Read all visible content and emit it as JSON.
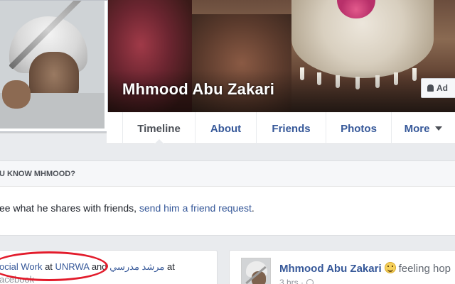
{
  "profile": {
    "name": "Mhmood Abu Zakari",
    "add_friend_label": "Ad"
  },
  "tabs": [
    {
      "label": "Timeline",
      "active": true
    },
    {
      "label": "About"
    },
    {
      "label": "Friends"
    },
    {
      "label": "Photos"
    },
    {
      "label": "More"
    }
  ],
  "know": {
    "heading": "U KNOW MHMOOD?",
    "body_prefix": "ee what he shares with friends, ",
    "body_link": "send him a friend request",
    "body_suffix": "."
  },
  "work": {
    "job": "ocial Work",
    "at1": " at ",
    "employer": "UNRWA",
    "and": " and ",
    "arabic_title": "مرشد مدرسي",
    "at2": " at",
    "via": "acebook"
  },
  "post": {
    "author": "Mhmood Abu Zakari",
    "feeling": "feeling hop",
    "time": "3 hrs ·"
  },
  "colors": {
    "link": "#365899",
    "highlight_oval": "#e21b2b",
    "background": "#e9ebee"
  }
}
